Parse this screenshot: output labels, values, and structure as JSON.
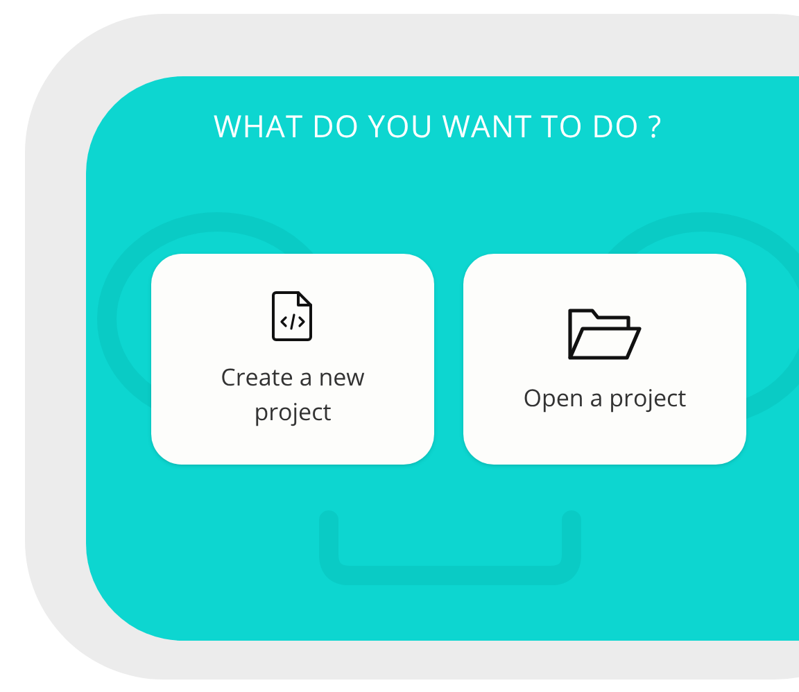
{
  "title": "WHAT DO YOU WANT TO DO ?",
  "actions": [
    {
      "kind": "new",
      "label": "Create a new project"
    },
    {
      "kind": "open",
      "label": "Open a project"
    }
  ]
}
